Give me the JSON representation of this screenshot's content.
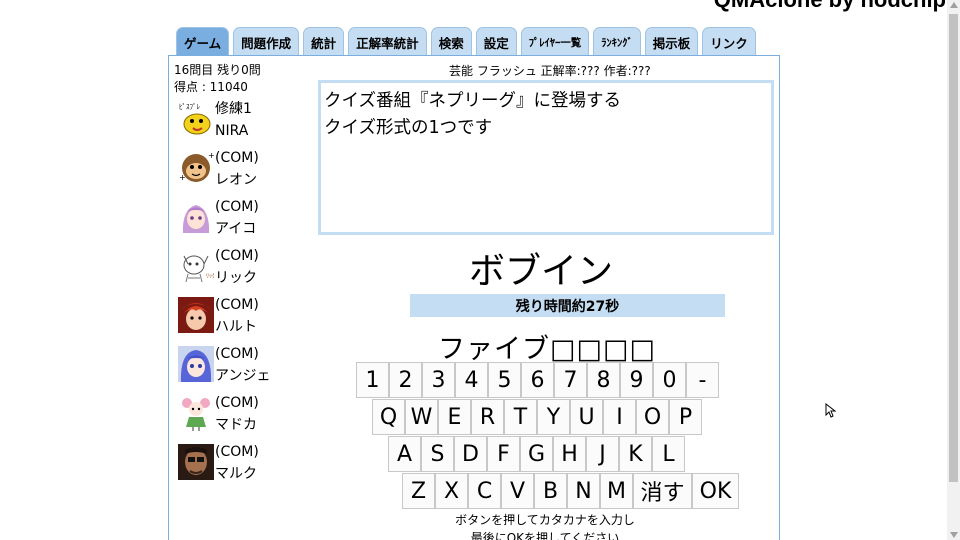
{
  "site": {
    "title": "QMAclone by nodchip"
  },
  "tabs": [
    {
      "label": "ゲーム",
      "active": true
    },
    {
      "label": "問題作成"
    },
    {
      "label": "統計"
    },
    {
      "label": "正解率統計"
    },
    {
      "label": "検索"
    },
    {
      "label": "設定"
    },
    {
      "label": "ﾌﾟﾚｲﾔｰ一覧"
    },
    {
      "label": "ﾗﾝｷﾝｸﾞ"
    },
    {
      "label": "掲示板"
    },
    {
      "label": "リンク"
    }
  ],
  "status": {
    "progress": "16問目 残り0問",
    "score": "得点 : 11040"
  },
  "players": [
    {
      "line1": "修練1",
      "line2": "NIRA",
      "avatar": "yellow-bird-avatar"
    },
    {
      "line1": "(COM)",
      "line2": "レオン",
      "avatar": "monkey-avatar"
    },
    {
      "line1": "(COM)",
      "line2": "アイコ",
      "avatar": "purple-hair-girl-avatar"
    },
    {
      "line1": "(COM)",
      "line2": "リック",
      "avatar": "cat-sketch-avatar"
    },
    {
      "line1": "(COM)",
      "line2": "ハルト",
      "avatar": "red-hair-boy-avatar"
    },
    {
      "line1": "(COM)",
      "line2": "アンジェ",
      "avatar": "blue-hair-girl-avatar"
    },
    {
      "line1": "(COM)",
      "line2": "マドカ",
      "avatar": "green-dress-girl-avatar"
    },
    {
      "line1": "(COM)",
      "line2": "マルク",
      "avatar": "dark-photo-avatar"
    }
  ],
  "quiz": {
    "meta": "芸能 フラッシュ 正解率:??? 作者:???",
    "question_line1": "クイズ番組『ネプリーグ』に登場する",
    "question_line2": "クイズ形式の1つです",
    "answer": "ボブイン",
    "time_remaining": "残り時間約27秒",
    "input": "ファイブ□□□□"
  },
  "keyboard": {
    "row1": [
      "1",
      "2",
      "3",
      "4",
      "5",
      "6",
      "7",
      "8",
      "9",
      "0",
      "-"
    ],
    "row2": [
      "Q",
      "W",
      "E",
      "R",
      "T",
      "Y",
      "U",
      "I",
      "O",
      "P"
    ],
    "row3": [
      "A",
      "S",
      "D",
      "F",
      "G",
      "H",
      "J",
      "K",
      "L"
    ],
    "row4": [
      "Z",
      "X",
      "C",
      "V",
      "B",
      "N",
      "M"
    ],
    "delete_label": "消す",
    "ok_label": "OK"
  },
  "hints": {
    "line1": "ボタンを押してカタカナを入力し",
    "line2": "最後にOKを押してください"
  }
}
